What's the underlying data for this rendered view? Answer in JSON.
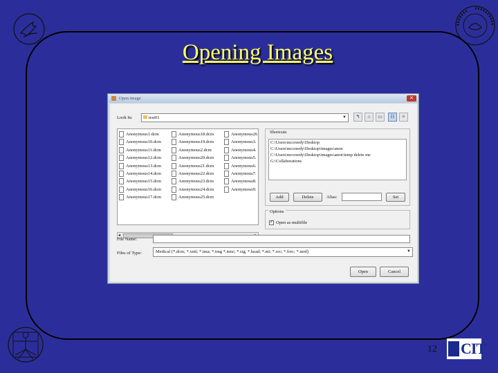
{
  "slide": {
    "title": "Opening Images",
    "page_number": "12",
    "cit_logo_text": "CIT"
  },
  "dialog": {
    "title": "Open image",
    "look_in_label": "Look In:",
    "look_in_value": "test01",
    "files": [
      [
        "Anonymous1.dcm",
        "Anonymous10.dcm",
        "Anonymous11.dcm",
        "Anonymous12.dcm",
        "Anonymous13.dcm",
        "Anonymous14.dcm",
        "Anonymous15.dcm",
        "Anonymous16.dcm",
        "Anonymous17.dcm"
      ],
      [
        "Anonymous18.dcm",
        "Anonymous19.dcm",
        "Anonymous2.dcm",
        "Anonymous20.dcm",
        "Anonymous21.dcm",
        "Anonymous22.dcm",
        "Anonymous23.dcm",
        "Anonymous24.dcm",
        "Anonymous25.dcm"
      ],
      [
        "Anonymous26",
        "Anonymous3.",
        "Anonymous4.",
        "Anonymous5.",
        "Anonymous6.",
        "Anonymous7.",
        "Anonymous8.",
        "Anonymous9.",
        ""
      ]
    ],
    "shortcuts_label": "Shortcuts",
    "shortcuts": [
      "C:\\Users\\mccreedy\\Desktop",
      "C:\\Users\\mccreedy\\Desktop\\images\\anon",
      "C:\\Users\\mccreedy\\Desktop\\images\\anon\\temp delete me",
      "G:\\Collaborations"
    ],
    "add_label": "Add",
    "delete_label": "Delete",
    "alias_label": "Alias:",
    "alias_value": "",
    "set_label": "Set",
    "options_label": "Options",
    "open_multifile_label": "Open as multifile",
    "open_multifile_checked": "✓",
    "file_name_label": "File Name:",
    "file_name_value": "",
    "files_of_type_label": "Files of Type:",
    "files_of_type_value": "Medical (*.dcm; *.xml; *.ima; *.img *.mnc; *.sig; *.head; *.nii; *.rec; *.frec; *.mrd)",
    "open_label": "Open",
    "cancel_label": "Cancel"
  }
}
